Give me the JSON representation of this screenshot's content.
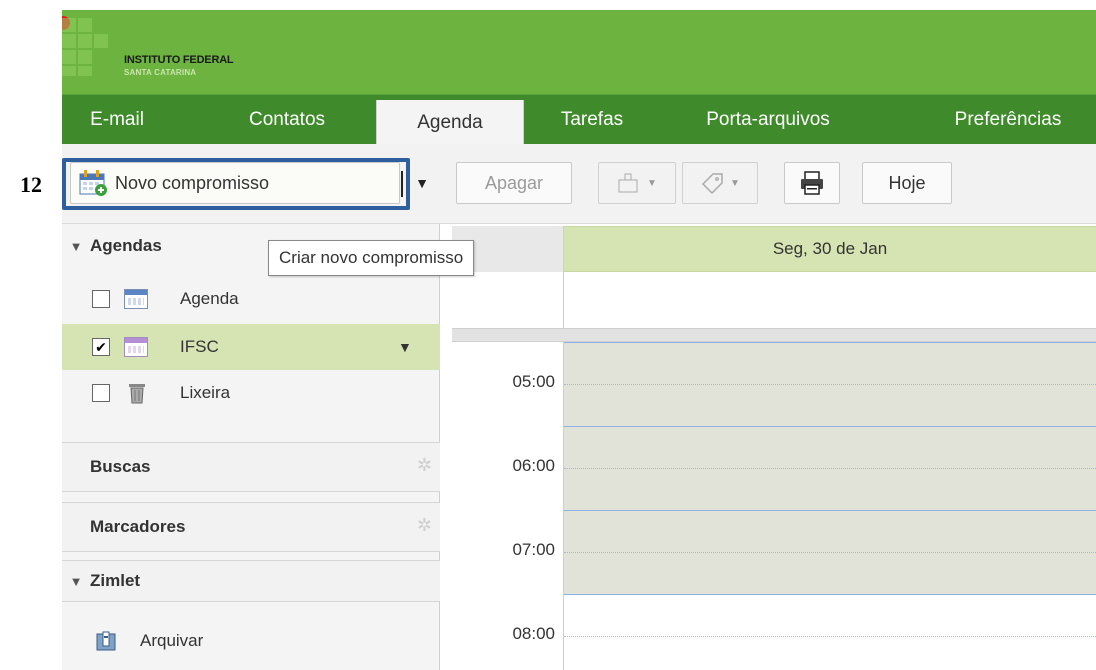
{
  "step_number": "12",
  "branding": {
    "title": "INSTITUTO FEDERAL",
    "subtitle": "SANTA CATARINA"
  },
  "tabs": [
    {
      "label": "E-mail",
      "active": false
    },
    {
      "label": "Contatos",
      "active": false
    },
    {
      "label": "Agenda",
      "active": true
    },
    {
      "label": "Tarefas",
      "active": false
    },
    {
      "label": "Porta-arquivos",
      "active": false
    },
    {
      "label": "Preferências",
      "active": false
    }
  ],
  "toolbar": {
    "new_appointment_label": "Novo compromisso",
    "delete_label": "Apagar",
    "today_label": "Hoje"
  },
  "tooltip": "Criar novo compromisso",
  "sidebar": {
    "calendars_header": "Agendas",
    "calendars": [
      {
        "label": "Agenda",
        "checked": false,
        "color": "#5b86c5"
      },
      {
        "label": "IFSC",
        "checked": true,
        "color": "#b48fd3"
      },
      {
        "label": "Lixeira",
        "checked": false
      }
    ],
    "searches_header": "Buscas",
    "tags_header": "Marcadores",
    "zimlet_header": "Zimlet",
    "zimlet_items": [
      {
        "label": "Arquivar"
      }
    ]
  },
  "calendar": {
    "day_header": "Seg, 30 de Jan",
    "hours": [
      "05:00",
      "06:00",
      "07:00",
      "08:00"
    ]
  },
  "colors": {
    "header_green": "#6db33f",
    "tab_green": "#3f8a2a",
    "selected_row": "#d6e3b3",
    "highlight_border": "#2e5e9e"
  }
}
